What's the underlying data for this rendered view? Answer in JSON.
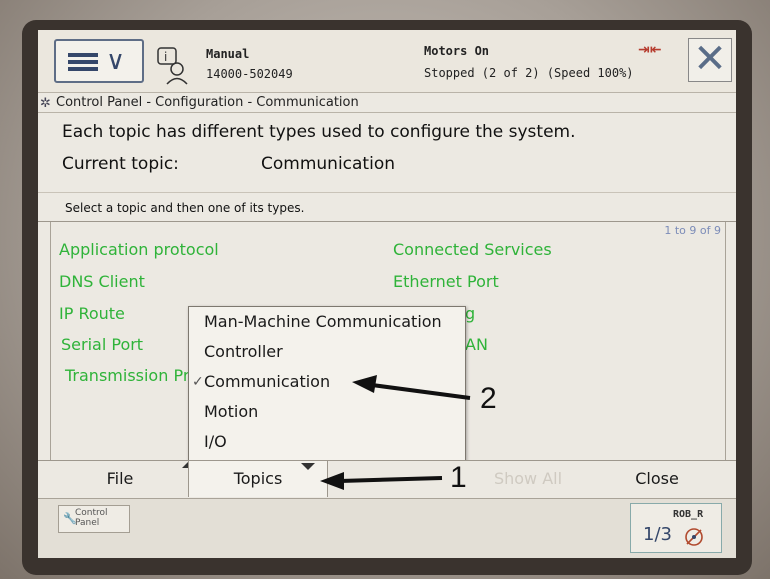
{
  "header": {
    "mode": "Manual",
    "controller_id": "14000-502049",
    "motors": "Motors On",
    "status": "Stopped (2 of 2) (Speed 100%)"
  },
  "breadcrumb": "Control Panel - Configuration - Communication",
  "info": {
    "description": "Each topic has different types used to configure the system.",
    "current_topic_label": "Current topic:",
    "current_topic_value": "Communication"
  },
  "hint": "Select a topic and then one of its types.",
  "list": {
    "count": "1 to 9 of 9",
    "items": [
      "Application protocol",
      "Connected Services",
      "DNS Client",
      "Ethernet Port",
      "IP Route",
      "g",
      "Serial Port",
      "AN",
      "Transmission Pr"
    ]
  },
  "dropdown": {
    "items": [
      "Man-Machine Communication",
      "Controller",
      "Communication",
      "Motion",
      "I/O"
    ],
    "selected_index": 2
  },
  "bottom": {
    "file": "File",
    "topics": "Topics",
    "show_all": "Show All",
    "close": "Close"
  },
  "statusbar": {
    "control_panel": "Control Panel",
    "robot": "ROB_R",
    "fraction": "1/3"
  },
  "annotations": {
    "arrow1": "1",
    "arrow2": "2"
  },
  "colors": {
    "topic_green": "#2fb339",
    "accent_blue": "#35476a"
  }
}
